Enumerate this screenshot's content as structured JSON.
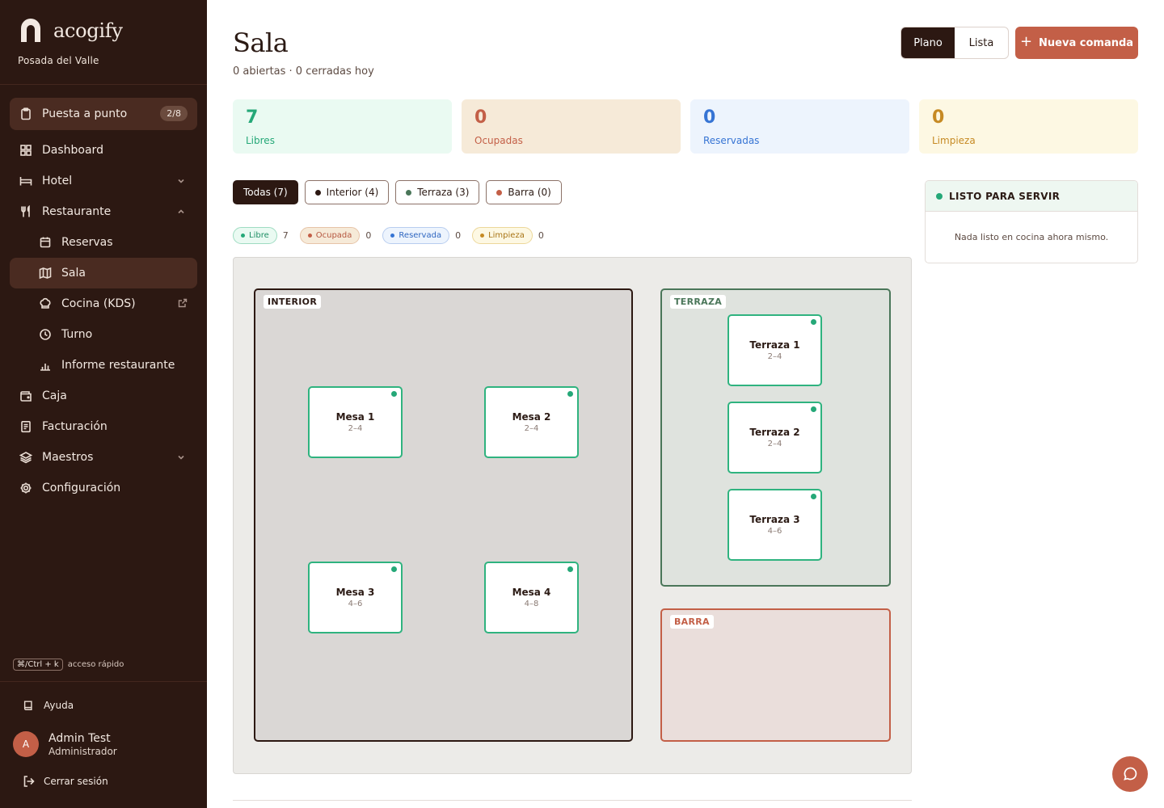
{
  "brand": {
    "name": "acogify",
    "property": "Posada del Valle"
  },
  "nav": {
    "setup": {
      "label": "Puesta a punto",
      "badge": "2/8"
    },
    "dashboard": "Dashboard",
    "hotel": "Hotel",
    "restaurant": "Restaurante",
    "reservations": "Reservas",
    "room": "Sala",
    "kitchen": "Cocina (KDS)",
    "shift": "Turno",
    "report": "Informe restaurante",
    "cash": "Caja",
    "billing": "Facturación",
    "masters": "Maestros",
    "settings": "Configuración"
  },
  "shortcut": {
    "key": "⌘/Ctrl + k",
    "label": "acceso rápido"
  },
  "footer": {
    "help": "Ayuda",
    "user_initial": "A",
    "user_name": "Admin Test",
    "user_role": "Administrador",
    "logout": "Cerrar sesión"
  },
  "header": {
    "title": "Sala",
    "subtitle": "0 abiertas · 0 cerradas hoy",
    "view_plan": "Plano",
    "view_list": "Lista",
    "new_order": "Nueva comanda"
  },
  "stats": {
    "free": {
      "value": "7",
      "label": "Libres"
    },
    "occupied": {
      "value": "0",
      "label": "Ocupadas"
    },
    "reserved": {
      "value": "0",
      "label": "Reservadas"
    },
    "cleaning": {
      "value": "0",
      "label": "Limpieza"
    }
  },
  "filters": {
    "all": "Todas (7)",
    "interior": "Interior (4)",
    "terrace": "Terraza (3)",
    "bar": "Barra (0)"
  },
  "legend": {
    "free": {
      "label": "Libre",
      "count": "7"
    },
    "occupied": {
      "label": "Ocupada",
      "count": "0"
    },
    "reserved": {
      "label": "Reservada",
      "count": "0"
    },
    "cleaning": {
      "label": "Limpieza",
      "count": "0"
    }
  },
  "zones": {
    "interior": "INTERIOR",
    "terrace": "TERRAZA",
    "bar": "BARRA"
  },
  "tables": {
    "mesa1": {
      "name": "Mesa 1",
      "capacity": "2–4"
    },
    "mesa2": {
      "name": "Mesa 2",
      "capacity": "2–4"
    },
    "mesa3": {
      "name": "Mesa 3",
      "capacity": "4–6"
    },
    "mesa4": {
      "name": "Mesa 4",
      "capacity": "4–8"
    },
    "terraza1": {
      "name": "Terraza 1",
      "capacity": "2–4"
    },
    "terraza2": {
      "name": "Terraza 2",
      "capacity": "2–4"
    },
    "terraza3": {
      "name": "Terraza 3",
      "capacity": "4–6"
    }
  },
  "ready": {
    "title": "LISTO PARA SERVIR",
    "empty": "Nada listo en cocina ahora mismo."
  },
  "colors": {
    "sidebar": "#2c1812",
    "accent": "#c35f47",
    "free": "#25a878",
    "occupied": "#c35f47",
    "reserved": "#3674d4",
    "cleaning": "#c68a24",
    "terrace": "#4a7659"
  }
}
